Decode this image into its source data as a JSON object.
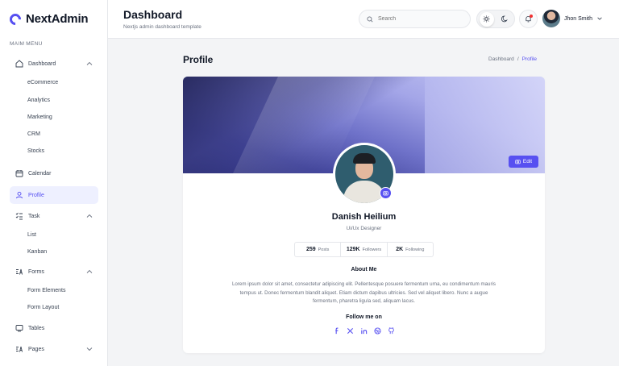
{
  "brand": {
    "name": "NextAdmin"
  },
  "sidebar": {
    "heading": "MAIM MENU",
    "dashboard": {
      "label": "Dashboard",
      "sub": [
        "eCommerce",
        "Analytics",
        "Marketing",
        "CRM",
        "Stocks"
      ]
    },
    "calendar": {
      "label": "Calendar"
    },
    "profile": {
      "label": "Profile"
    },
    "task": {
      "label": "Task",
      "sub": [
        "List",
        "Kanban"
      ]
    },
    "forms": {
      "label": "Forms",
      "sub": [
        "Form Elements",
        "Form Layout"
      ]
    },
    "tables": {
      "label": "Tables"
    },
    "pages": {
      "label": "Pages"
    }
  },
  "header": {
    "title": "Dashboard",
    "subtitle": "Nextjs admin dashboard template",
    "search_placeholder": "Search",
    "user_name": "Jhon Smith"
  },
  "page": {
    "title": "Profile",
    "breadcrumb": [
      "Dashboard",
      "/",
      "Profile"
    ]
  },
  "profile": {
    "edit_label": "Edit",
    "name": "Danish Heilium",
    "role": "Ui/Ux Designer",
    "stats": [
      {
        "value": "259",
        "label": "Posts"
      },
      {
        "value": "129K",
        "label": "Followers"
      },
      {
        "value": "2K",
        "label": "Following"
      }
    ],
    "about_title": "About Me",
    "about_text": "Lorem ipsum dolor sit amet, consectetur adipiscing elit. Pellentesque posuere fermentum urna, eu condimentum mauris tempus ut. Donec fermentum blandit aliquet. Etiam dictum dapibus ultricies. Sed vel aliquet libero. Nunc a augue fermentum, pharetra ligula sed, aliquam lacus.",
    "follow_title": "Follow me on",
    "socials": [
      "facebook-icon",
      "x-icon",
      "linkedin-icon",
      "dribbble-icon",
      "github-icon"
    ]
  },
  "colors": {
    "accent": "#5750f1",
    "background": "#f3f4f6",
    "notification": "#f23030"
  }
}
